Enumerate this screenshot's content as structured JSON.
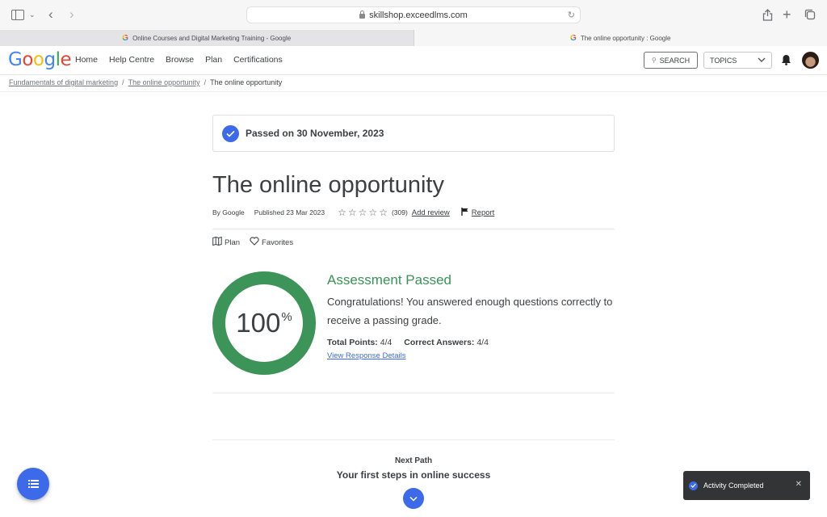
{
  "browser": {
    "url": "skillshop.exceedlms.com",
    "tabs": [
      {
        "title": "Online Courses and Digital Marketing Training - Google",
        "active": false
      },
      {
        "title": "The online opportunity : Google",
        "active": true
      }
    ]
  },
  "header": {
    "logo": [
      "G",
      "o",
      "o",
      "g",
      "l",
      "e"
    ],
    "nav": [
      "Home",
      "Help Centre",
      "Browse",
      "Plan",
      "Certifications"
    ],
    "search_label": "SEARCH",
    "topics_label": "TOPICS"
  },
  "breadcrumb": {
    "items": [
      "Fundamentals of digital marketing",
      "The online opportunity"
    ],
    "current": "The online opportunity",
    "separator": "/"
  },
  "status": {
    "passed_text": "Passed on 30 November, 2023"
  },
  "course": {
    "title": "The online opportunity",
    "author": "By Google",
    "published": "Published 23 Mar 2023",
    "rating_count": "(309)",
    "add_review": "Add review",
    "report": "Report",
    "plan": "Plan",
    "favorites": "Favorites"
  },
  "result": {
    "score": "100",
    "score_unit": "%",
    "score_fraction": 1.0,
    "heading": "Assessment Passed",
    "message": "Congratulations! You answered enough questions correctly to receive a passing grade.",
    "total_points_label": "Total Points:",
    "total_points": "4/4",
    "correct_answers_label": "Correct Answers:",
    "correct_answers": "4/4",
    "view_link": "View Response Details",
    "color": "#3d9458"
  },
  "next": {
    "label": "Next Path",
    "title": "Your first steps in online success"
  },
  "toast": {
    "text": "Activity Completed"
  },
  "colors": {
    "accent": "#3d6ae8",
    "success": "#3a9258"
  }
}
